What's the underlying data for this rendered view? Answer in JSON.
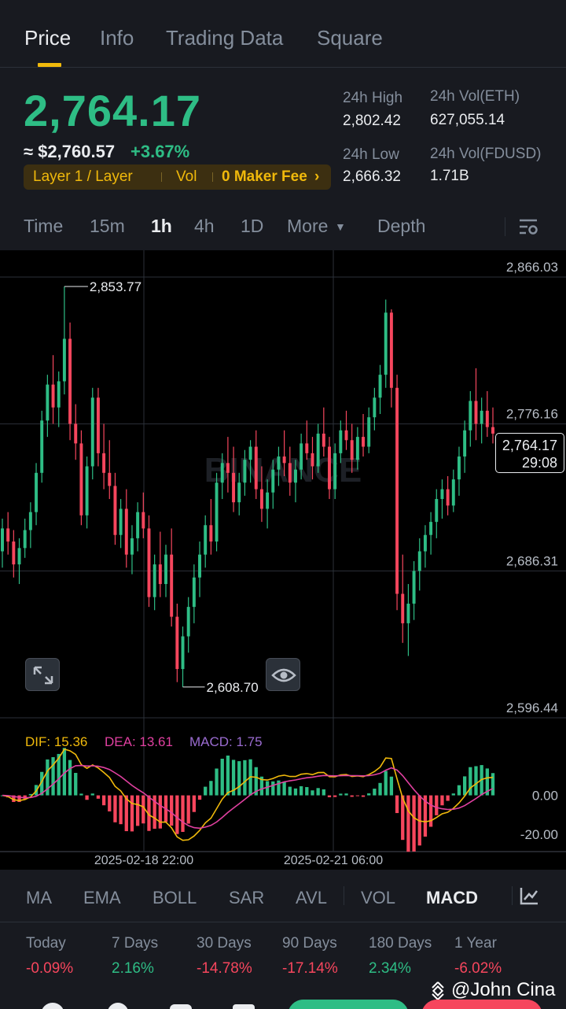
{
  "tabs": [
    {
      "label": "Price",
      "active": true
    },
    {
      "label": "Info",
      "active": false
    },
    {
      "label": "Trading Data",
      "active": false
    },
    {
      "label": "Square",
      "active": false
    }
  ],
  "header": {
    "price": "2,764.17",
    "approx": "≈ $2,760.57",
    "change": "+3.67%",
    "tags": {
      "category": "Layer 1 / Layer",
      "vol": "Vol",
      "fee": "0 Maker Fee"
    },
    "stats": {
      "high_label": "24h High",
      "high_value": "2,802.42",
      "low_label": "24h Low",
      "low_value": "2,666.32",
      "vol_base_label": "24h Vol(ETH)",
      "vol_base_value": "627,055.14",
      "vol_quote_label": "24h Vol(FDUSD)",
      "vol_quote_value": "1.71B"
    }
  },
  "intervals": [
    {
      "label": "Time",
      "active": false
    },
    {
      "label": "15m",
      "active": false
    },
    {
      "label": "1h",
      "active": true
    },
    {
      "label": "4h",
      "active": false
    },
    {
      "label": "1D",
      "active": false
    },
    {
      "label": "More",
      "active": false
    },
    {
      "label": "Depth",
      "active": false
    }
  ],
  "chart_data": {
    "type": "candlestick",
    "interval": "1h",
    "watermark": "BINANCE",
    "y_ticks": [
      "2,866.03",
      "2,776.16",
      "2,686.31",
      "2,596.44"
    ],
    "ylim": [
      2596.44,
      2866.03
    ],
    "max_marker": "2,853.77",
    "min_marker": "2,608.70",
    "current_price": "2,764.17",
    "countdown": "29:08",
    "x_labels": [
      "2025-02-18 22:00",
      "2025-02-21 06:00"
    ],
    "candles": [
      [
        2692,
        2712,
        2682,
        2706
      ],
      [
        2706,
        2716,
        2690,
        2698
      ],
      [
        2698,
        2705,
        2676,
        2684
      ],
      [
        2684,
        2700,
        2672,
        2694
      ],
      [
        2694,
        2712,
        2688,
        2705
      ],
      [
        2705,
        2722,
        2694,
        2716
      ],
      [
        2716,
        2746,
        2708,
        2740
      ],
      [
        2740,
        2778,
        2734,
        2772
      ],
      [
        2772,
        2800,
        2762,
        2794
      ],
      [
        2794,
        2812,
        2770,
        2780
      ],
      [
        2780,
        2802,
        2768,
        2796
      ],
      [
        2796,
        2854,
        2788,
        2822
      ],
      [
        2822,
        2832,
        2760,
        2770
      ],
      [
        2770,
        2782,
        2748,
        2758
      ],
      [
        2758,
        2766,
        2708,
        2714
      ],
      [
        2714,
        2750,
        2706,
        2744
      ],
      [
        2744,
        2792,
        2736,
        2786
      ],
      [
        2786,
        2792,
        2744,
        2752
      ],
      [
        2752,
        2770,
        2730,
        2740
      ],
      [
        2740,
        2760,
        2724,
        2732
      ],
      [
        2732,
        2740,
        2696,
        2702
      ],
      [
        2702,
        2724,
        2694,
        2718
      ],
      [
        2718,
        2730,
        2682,
        2690
      ],
      [
        2690,
        2708,
        2678,
        2700
      ],
      [
        2700,
        2722,
        2692,
        2716
      ],
      [
        2716,
        2728,
        2700,
        2706
      ],
      [
        2706,
        2714,
        2658,
        2664
      ],
      [
        2664,
        2690,
        2656,
        2684
      ],
      [
        2684,
        2704,
        2664,
        2672
      ],
      [
        2672,
        2696,
        2664,
        2690
      ],
      [
        2690,
        2706,
        2646,
        2652
      ],
      [
        2652,
        2660,
        2612,
        2620
      ],
      [
        2620,
        2646,
        2609,
        2640
      ],
      [
        2640,
        2664,
        2630,
        2658
      ],
      [
        2658,
        2684,
        2648,
        2676
      ],
      [
        2676,
        2698,
        2664,
        2690
      ],
      [
        2690,
        2714,
        2682,
        2708
      ],
      [
        2708,
        2724,
        2690,
        2698
      ],
      [
        2698,
        2740,
        2692,
        2734
      ],
      [
        2734,
        2752,
        2724,
        2746
      ],
      [
        2746,
        2762,
        2728,
        2740
      ],
      [
        2740,
        2756,
        2716,
        2722
      ],
      [
        2722,
        2740,
        2714,
        2734
      ],
      [
        2734,
        2754,
        2726,
        2748
      ],
      [
        2748,
        2760,
        2734,
        2756
      ],
      [
        2756,
        2766,
        2724,
        2730
      ],
      [
        2730,
        2744,
        2710,
        2718
      ],
      [
        2718,
        2736,
        2706,
        2728
      ],
      [
        2728,
        2748,
        2718,
        2742
      ],
      [
        2742,
        2756,
        2732,
        2750
      ],
      [
        2750,
        2766,
        2738,
        2746
      ],
      [
        2746,
        2756,
        2726,
        2734
      ],
      [
        2734,
        2748,
        2722,
        2742
      ],
      [
        2742,
        2764,
        2736,
        2758
      ],
      [
        2758,
        2772,
        2748,
        2752
      ],
      [
        2752,
        2762,
        2736,
        2744
      ],
      [
        2744,
        2770,
        2740,
        2764
      ],
      [
        2764,
        2780,
        2750,
        2756
      ],
      [
        2756,
        2762,
        2724,
        2730
      ],
      [
        2730,
        2758,
        2724,
        2752
      ],
      [
        2752,
        2772,
        2746,
        2766
      ],
      [
        2766,
        2778,
        2754,
        2760
      ],
      [
        2760,
        2770,
        2740,
        2748
      ],
      [
        2748,
        2768,
        2742,
        2762
      ],
      [
        2762,
        2776,
        2750,
        2756
      ],
      [
        2756,
        2780,
        2752,
        2774
      ],
      [
        2774,
        2792,
        2766,
        2786
      ],
      [
        2786,
        2806,
        2776,
        2800
      ],
      [
        2800,
        2846,
        2792,
        2838
      ],
      [
        2838,
        2840,
        2780,
        2792
      ],
      [
        2792,
        2800,
        2656,
        2666
      ],
      [
        2666,
        2690,
        2636,
        2648
      ],
      [
        2648,
        2672,
        2628,
        2660
      ],
      [
        2660,
        2686,
        2650,
        2680
      ],
      [
        2680,
        2700,
        2668,
        2692
      ],
      [
        2692,
        2708,
        2682,
        2702
      ],
      [
        2702,
        2716,
        2690,
        2710
      ],
      [
        2710,
        2730,
        2700,
        2724
      ],
      [
        2724,
        2736,
        2712,
        2730
      ],
      [
        2730,
        2738,
        2714,
        2720
      ],
      [
        2720,
        2742,
        2716,
        2736
      ],
      [
        2736,
        2756,
        2726,
        2750
      ],
      [
        2750,
        2772,
        2740,
        2766
      ],
      [
        2766,
        2790,
        2756,
        2784
      ],
      [
        2784,
        2804,
        2760,
        2770
      ],
      [
        2770,
        2786,
        2758,
        2778
      ],
      [
        2778,
        2790,
        2762,
        2768
      ],
      [
        2768,
        2780,
        2758,
        2764
      ]
    ],
    "macd": {
      "dif_label": "DIF: 15.36",
      "dea_label": "DEA: 13.61",
      "macd_label": "MACD: 1.75",
      "y_ticks": [
        "0.00",
        "-20.00"
      ],
      "ylim": [
        -28,
        22
      ]
    }
  },
  "indicators": [
    {
      "label": "MA",
      "active": false
    },
    {
      "label": "EMA",
      "active": false
    },
    {
      "label": "BOLL",
      "active": false
    },
    {
      "label": "SAR",
      "active": false
    },
    {
      "label": "AVL",
      "active": false
    },
    {
      "label": "VOL",
      "active": false
    },
    {
      "label": "MACD",
      "active": true
    }
  ],
  "performance": [
    {
      "label": "Today",
      "value": "-0.09%"
    },
    {
      "label": "7 Days",
      "value": "2.16%"
    },
    {
      "label": "30 Days",
      "value": "-14.78%"
    },
    {
      "label": "90 Days",
      "value": "-17.14%"
    },
    {
      "label": "180 Days",
      "value": "2.34%"
    },
    {
      "label": "1 Year",
      "value": "-6.02%"
    }
  ],
  "watermark_user": "@John Cina",
  "colors": {
    "up": "#2ebd85",
    "down": "#f6465d",
    "accent": "#f0b90b",
    "dif": "#f0b90b",
    "dea": "#e040a0",
    "macd": "#9b6cd1"
  }
}
